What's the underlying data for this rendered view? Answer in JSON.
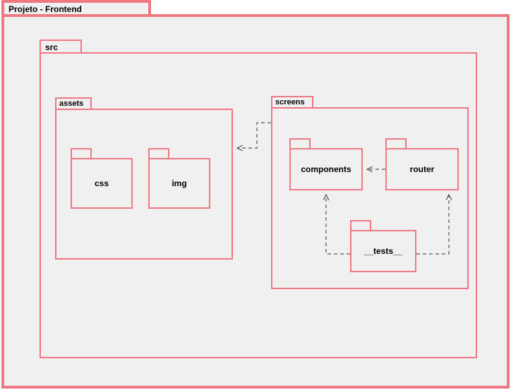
{
  "diagram": {
    "title": "Projeto - Frontend",
    "src": {
      "label": "src",
      "assets": {
        "label": "assets",
        "css": "css",
        "img": "img"
      },
      "screens": {
        "label": "screens",
        "components": "components",
        "router": "router",
        "tests": "__tests__"
      }
    }
  }
}
